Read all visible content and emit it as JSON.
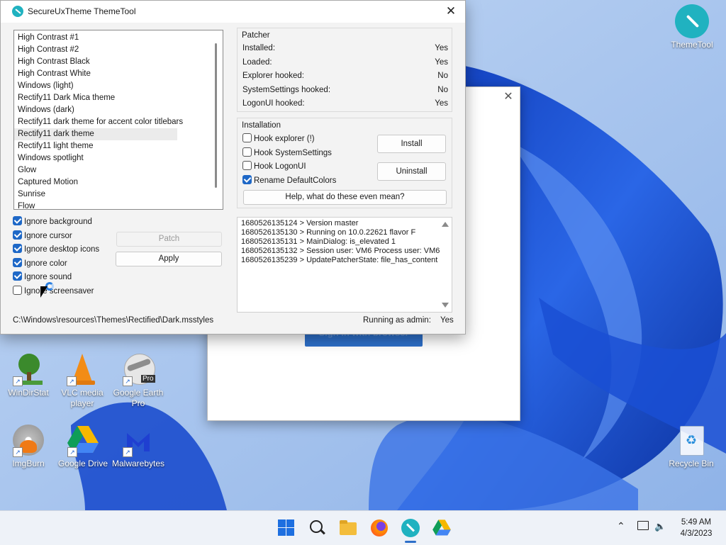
{
  "window": {
    "title": "SecureUxTheme ThemeTool",
    "close_glyph": "✕"
  },
  "themes": [
    "High Contrast #1",
    "High Contrast #2",
    "High Contrast Black",
    "High Contrast White",
    "Windows (light)",
    "Rectify11 Dark Mica theme",
    "Windows (dark)",
    "Rectify11 dark theme for accent color titlebars",
    "Rectify11 dark theme",
    "Rectify11 light theme",
    "Windows spotlight",
    "Glow",
    "Captured Motion",
    "Sunrise",
    "Flow"
  ],
  "selected_theme": "Rectify11 dark theme",
  "options": {
    "ignore_background": {
      "label": "Ignore background",
      "checked": true
    },
    "ignore_cursor": {
      "label": "Ignore cursor",
      "checked": true
    },
    "ignore_desktop_icons": {
      "label": "Ignore desktop icons",
      "checked": true
    },
    "ignore_color": {
      "label": "Ignore color",
      "checked": true
    },
    "ignore_sound": {
      "label": "Ignore sound",
      "checked": true
    },
    "ignore_screensaver": {
      "label": "Ignore screensaver",
      "checked": false
    }
  },
  "buttons": {
    "patch": "Patch",
    "apply": "Apply",
    "install": "Install",
    "uninstall": "Uninstall",
    "help": "Help, what do these even mean?"
  },
  "theme_path": "C:\\Windows\\resources\\Themes\\Rectified\\Dark.msstyles",
  "running_as_admin": {
    "label": "Running as admin:",
    "value": "Yes"
  },
  "patcher": {
    "title": "Patcher",
    "rows": [
      {
        "label": "Installed:",
        "value": "Yes"
      },
      {
        "label": "Loaded:",
        "value": "Yes"
      },
      {
        "label": "Explorer hooked:",
        "value": "No"
      },
      {
        "label": "SystemSettings hooked:",
        "value": "No"
      },
      {
        "label": "LogonUI hooked:",
        "value": "Yes"
      }
    ]
  },
  "installation": {
    "title": "Installation",
    "hook_explorer": {
      "label": "Hook explorer (!)",
      "checked": false
    },
    "hook_systemsettings": {
      "label": "Hook SystemSettings",
      "checked": false
    },
    "hook_logonui": {
      "label": "Hook LogonUI",
      "checked": false
    },
    "rename_defaultcolors": {
      "label": "Rename DefaultColors",
      "checked": true
    }
  },
  "log_lines": [
    "1680526135124 > Version master",
    "1680526135130 > Running on 10.0.22621 flavor F",
    "1680526135131 > MainDialog: is_elevated 1",
    "1680526135132 > Session user: VM6 Process user: VM6",
    "1680526135239 > UpdatePatcherState: file_has_content"
  ],
  "background_dialog": {
    "close_glyph": "✕",
    "button_label": "Sign in with browser"
  },
  "desktop_icons": {
    "themetool": "ThemeTool",
    "windirstat": "WinDirStat",
    "vlc": "VLC media player",
    "google_earth": "Google Earth Pro",
    "google_earth_badge": "Pro",
    "imgburn": "ImgBurn",
    "google_drive": "Google Drive",
    "malwarebytes": "Malwarebytes",
    "recycle_bin": "Recycle Bin"
  },
  "taskbar": {
    "time": "5:49 AM",
    "date": "4/3/2023"
  },
  "colors": {
    "accent": "#1e68c7",
    "wallpaper": "#9fc0ee",
    "ribbon": "#1547c8"
  }
}
